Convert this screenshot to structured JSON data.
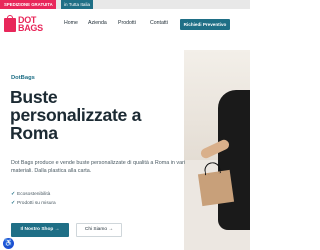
{
  "topbar": {
    "shipping_badge": "SPEDIZIONE GRATUITA",
    "shipping_text": "in Tutta Italia"
  },
  "header": {
    "logo_line1": "DOT",
    "logo_line2": "BAGS",
    "nav": [
      "Home",
      "Azienda",
      "Prodotti",
      "Contatti"
    ],
    "cta": "Richiedi Preventivo"
  },
  "hero": {
    "brand": "DotBags",
    "title_lines": [
      "Buste",
      "personalizzate a",
      "Roma"
    ],
    "description": "Dot Bags produce e vende buste personalizzate di qualità a Roma in vari materiali. Dalla plastica alla carta.",
    "features": [
      "Ecosostenibilità",
      "Prodotti su misura"
    ],
    "shop_button": "Il Nostro Shop →",
    "about_button": "Chi Siamo →"
  },
  "colors": {
    "accent_pink": "#e8275a",
    "primary_teal": "#1f6f86",
    "text_dark": "#1c2a33"
  },
  "icons": {
    "accessibility": "accessibility-icon",
    "check": "check-icon"
  }
}
